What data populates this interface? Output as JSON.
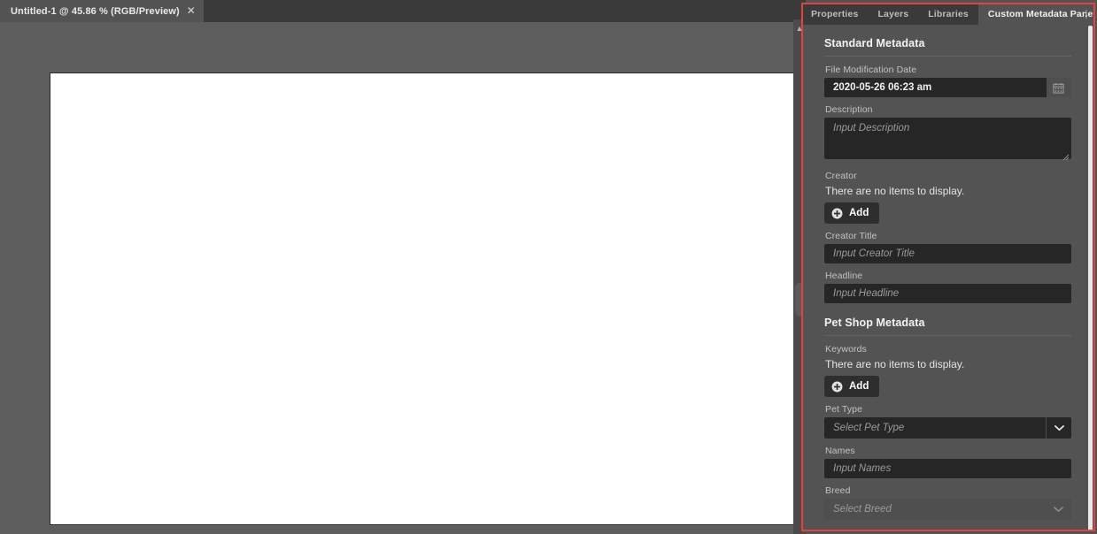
{
  "document": {
    "tab_title": "Untitled-1 @ 45.86 % (RGB/Preview)",
    "close_icon": "close-icon",
    "zoom_level": "45.86 %",
    "color_mode": "RGB/Preview"
  },
  "panel": {
    "tabs": [
      {
        "label": "Properties",
        "active": false
      },
      {
        "label": "Layers",
        "active": false
      },
      {
        "label": "Libraries",
        "active": false
      },
      {
        "label": "Custom Metadata Panel",
        "active": true
      }
    ],
    "menu_icon": "panel-menu-icon",
    "collapse_icon": "chevron-up-icon",
    "highlight_color": "#e0443e"
  },
  "standard_metadata": {
    "title": "Standard Metadata",
    "file_modification_date": {
      "label": "File Modification Date",
      "value": "2020-05-26 06:23 am",
      "button_icon": "calendar-icon"
    },
    "description": {
      "label": "Description",
      "value": "",
      "placeholder": "Input Description"
    },
    "creator": {
      "label": "Creator",
      "empty_message": "There are no items to display.",
      "add_label": "Add",
      "add_icon": "plus-circle-icon"
    },
    "creator_title": {
      "label": "Creator Title",
      "value": "",
      "placeholder": "Input Creator Title"
    },
    "headline": {
      "label": "Headline",
      "value": "",
      "placeholder": "Input Headline"
    }
  },
  "pet_shop_metadata": {
    "title": "Pet Shop Metadata",
    "keywords": {
      "label": "Keywords",
      "empty_message": "There are no items to display.",
      "add_label": "Add",
      "add_icon": "plus-circle-icon"
    },
    "pet_type": {
      "label": "Pet Type",
      "value": "Select Pet Type",
      "caret_icon": "chevron-down-icon",
      "disabled": false
    },
    "names": {
      "label": "Names",
      "value": "",
      "placeholder": "Input Names"
    },
    "breed": {
      "label": "Breed",
      "value": "Select Breed",
      "caret_icon": "chevron-down-icon",
      "disabled": true
    }
  }
}
